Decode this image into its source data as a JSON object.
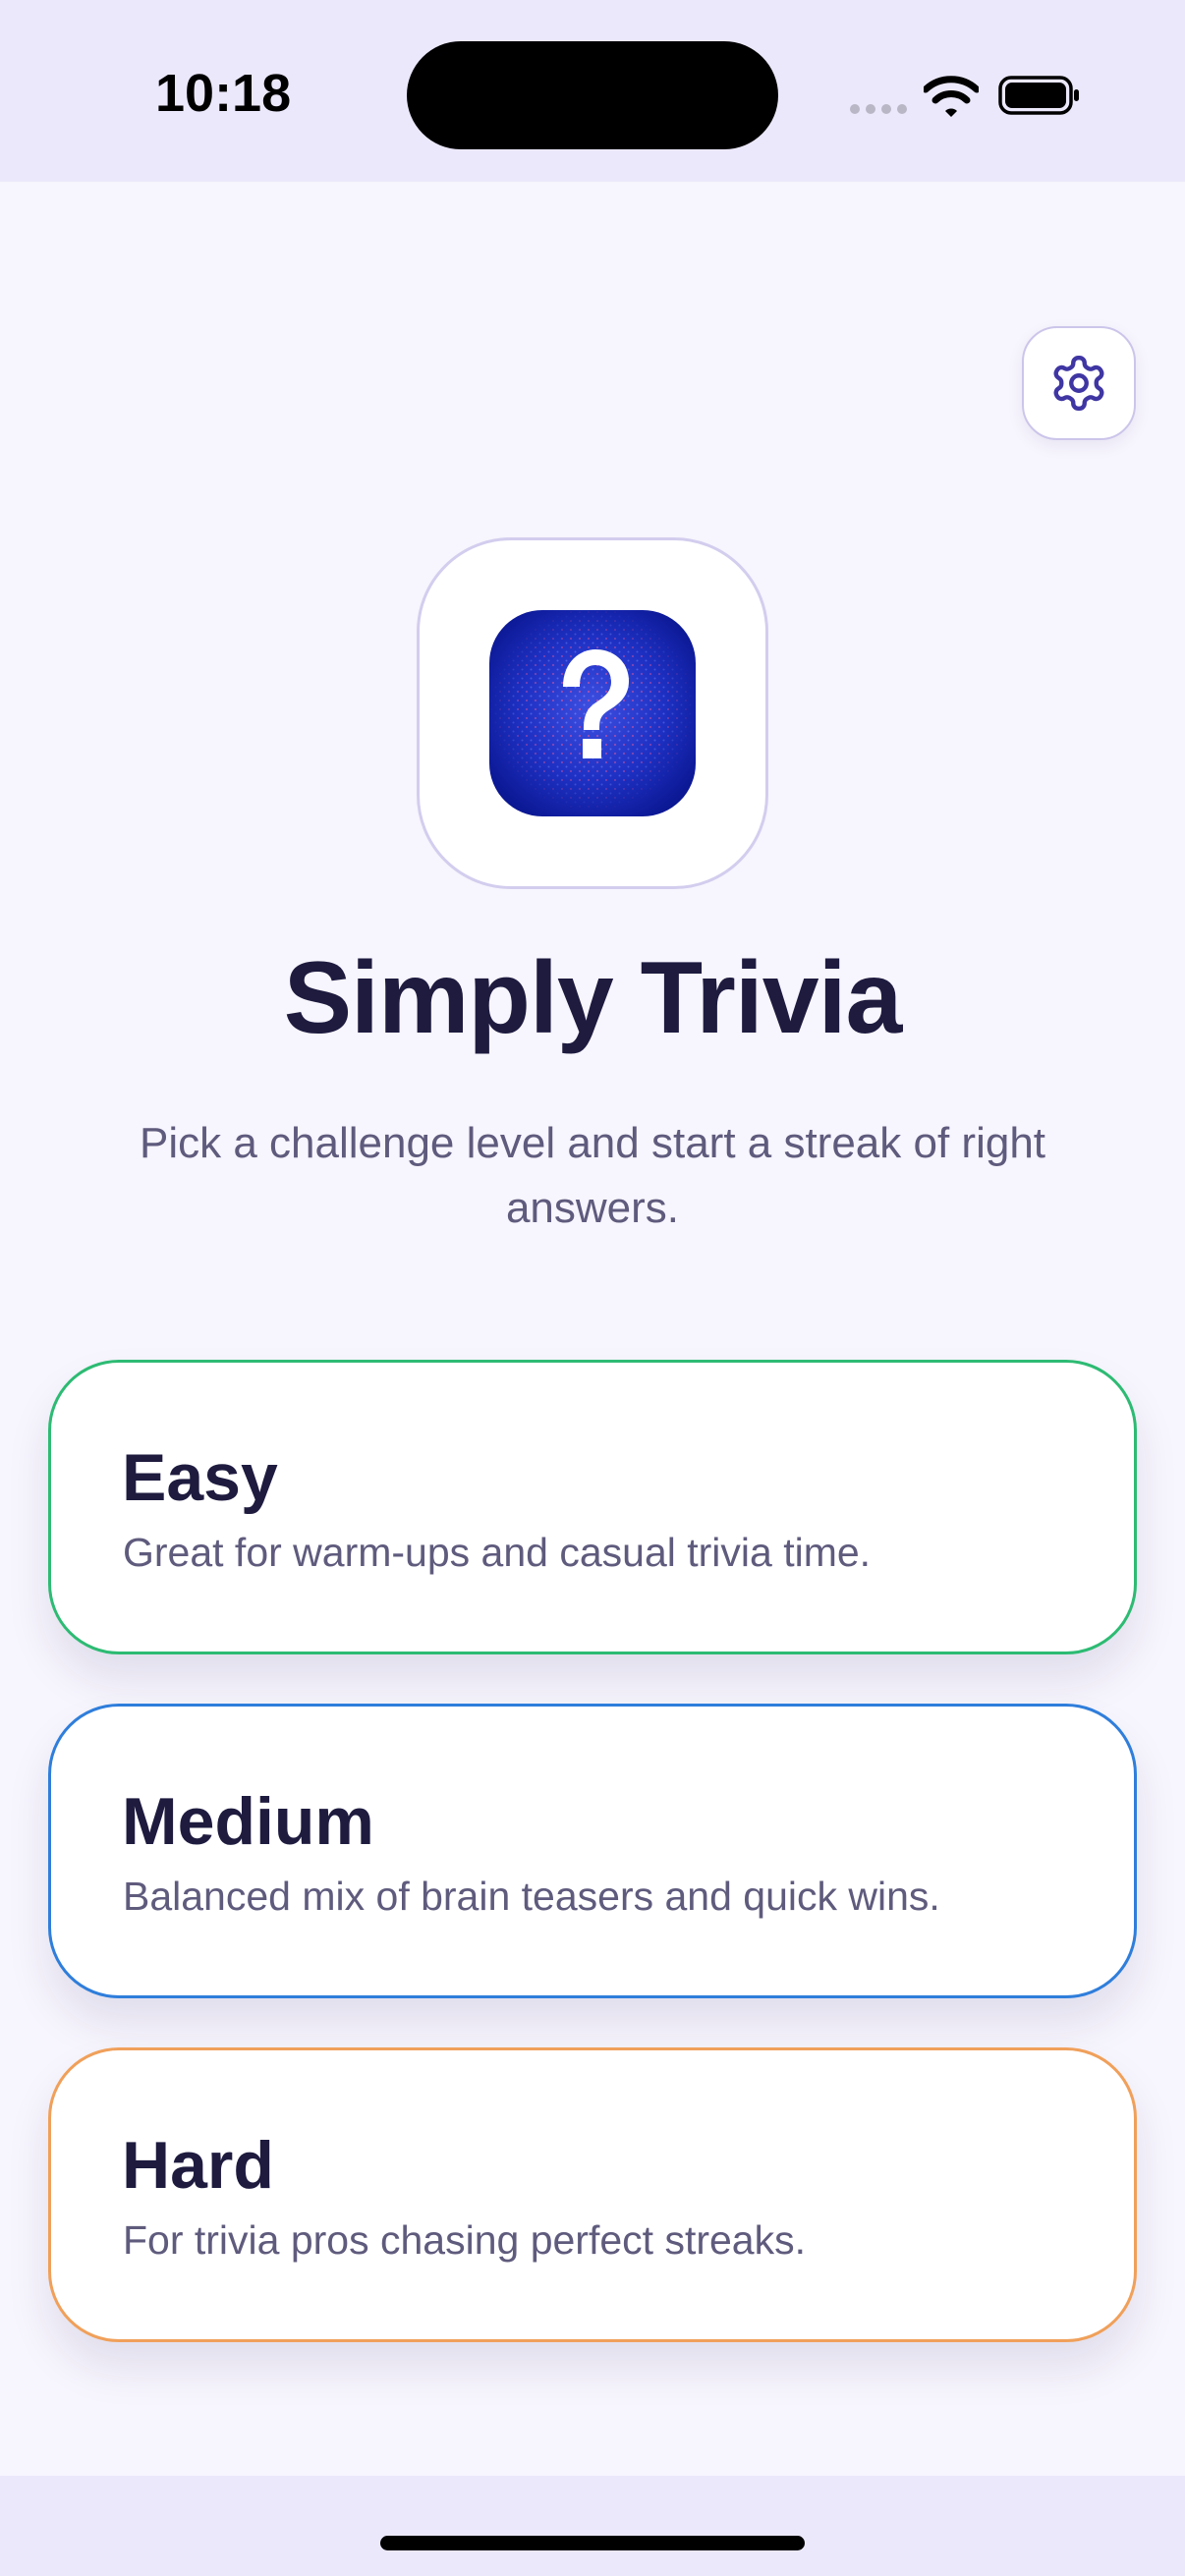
{
  "status_bar": {
    "time": "10:18"
  },
  "header": {
    "settings_icon": "gear-icon"
  },
  "hero": {
    "logo_icon": "question-mark-icon",
    "title": "Simply Trivia",
    "subtitle": "Pick a challenge level and start a streak of right answers."
  },
  "levels": [
    {
      "title": "Easy",
      "description": "Great for warm-ups and casual trivia time.",
      "accent": "#2DBB73"
    },
    {
      "title": "Medium",
      "description": "Balanced mix of brain teasers and quick wins.",
      "accent": "#2F7EDB"
    },
    {
      "title": "Hard",
      "description": "For trivia pros chasing perfect streaks.",
      "accent": "#F0A05A"
    }
  ],
  "colors": {
    "background": "#F7F5FD",
    "bars": "#ECE8FB",
    "title_text": "#1E1B3F",
    "body_text": "#5F5B7D",
    "settings_icon": "#3F36A3",
    "logo_blue": "#0D1FA8"
  }
}
